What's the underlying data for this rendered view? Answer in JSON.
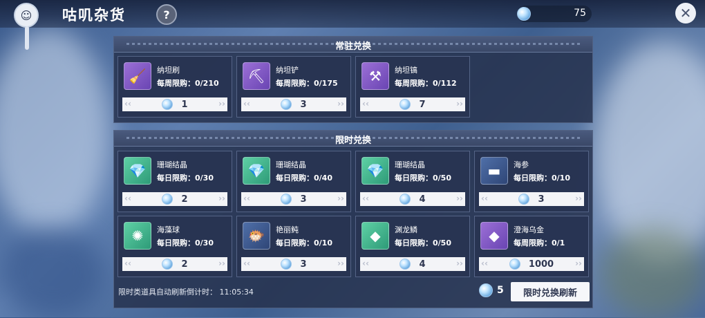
{
  "header": {
    "title": "咕叽杂货",
    "help_icon": "?",
    "currency_amount": "75",
    "close_icon": "✕"
  },
  "permanent": {
    "title": "常驻兑换",
    "items": [
      {
        "name": "纳坦刷",
        "limit": "每周限购：0/210",
        "price": "1",
        "icon": "🧹",
        "icon_class": "icon-purple"
      },
      {
        "name": "纳坦铲",
        "limit": "每周限购：0/175",
        "price": "3",
        "icon": "⛏",
        "icon_class": "icon-purple"
      },
      {
        "name": "纳坦镐",
        "limit": "每周限购：0/112",
        "price": "7",
        "icon": "⚒",
        "icon_class": "icon-purple"
      }
    ]
  },
  "limited": {
    "title": "限时兑换",
    "items": [
      {
        "name": "珊瑚结晶",
        "limit": "每日限购：0/30",
        "price": "2",
        "icon": "💎",
        "icon_class": "icon-green"
      },
      {
        "name": "珊瑚结晶",
        "limit": "每日限购：0/40",
        "price": "3",
        "icon": "💎",
        "icon_class": "icon-green"
      },
      {
        "name": "珊瑚结晶",
        "limit": "每日限购：0/50",
        "price": "4",
        "icon": "💎",
        "icon_class": "icon-green"
      },
      {
        "name": "海参",
        "limit": "每日限购：0/10",
        "price": "3",
        "icon": "▬",
        "icon_class": "icon-blue"
      },
      {
        "name": "海藻球",
        "limit": "每日限购：0/30",
        "price": "2",
        "icon": "✺",
        "icon_class": "icon-green"
      },
      {
        "name": "艳丽鲀",
        "limit": "每日限购：0/10",
        "price": "3",
        "icon": "🐡",
        "icon_class": "icon-blue"
      },
      {
        "name": "渊龙鳞",
        "limit": "每日限购：0/50",
        "price": "4",
        "icon": "◆",
        "icon_class": "icon-green"
      },
      {
        "name": "澄海乌金",
        "limit": "每周限购：0/1",
        "price": "1000",
        "icon": "◆",
        "icon_class": "icon-purple"
      }
    ]
  },
  "footer": {
    "countdown_text": "限时类道具自动刷新倒计时：  11:05:34",
    "refresh_cost": "5",
    "refresh_button": "限时兑换刷新"
  },
  "colors": {
    "panel": "#26324e",
    "price_bg": "#f3f4f7",
    "gem": "#6aa9df"
  }
}
